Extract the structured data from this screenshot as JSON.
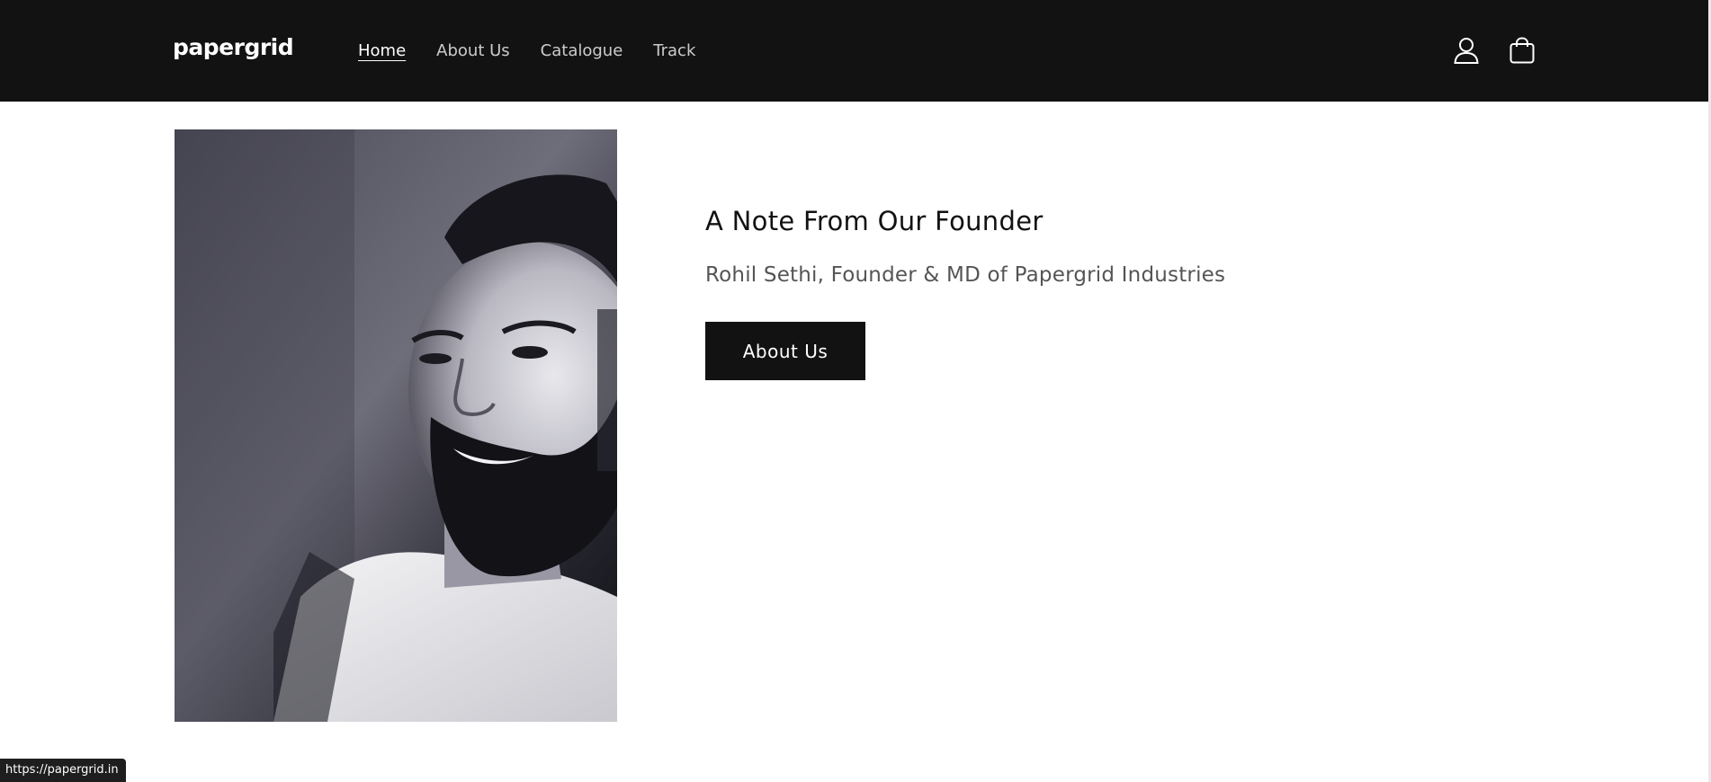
{
  "header": {
    "logo": "papergrid",
    "nav": [
      {
        "label": "Home",
        "active": true
      },
      {
        "label": "About Us",
        "active": false
      },
      {
        "label": "Catalogue",
        "active": false
      },
      {
        "label": "Track",
        "active": false
      }
    ],
    "icons": [
      "account-icon",
      "cart-icon"
    ],
    "background": "#121212"
  },
  "founder": {
    "image_alt": "Black and white portrait of the founder",
    "heading": "A Note From Our Founder",
    "subtitle": "Rohil Sethi, Founder & MD of Papergrid Industries",
    "button_label": "About Us"
  },
  "status_bar": {
    "url": "https://papergrid.in"
  },
  "colors": {
    "primary": "#121212",
    "background": "#ffffff"
  }
}
